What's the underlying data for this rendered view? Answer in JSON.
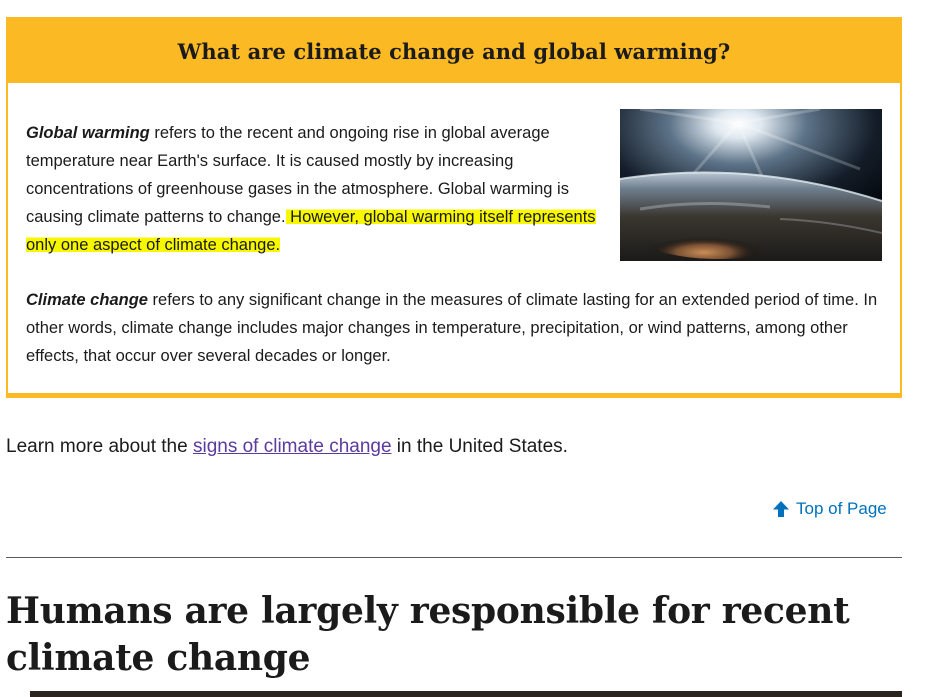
{
  "box": {
    "title": "What are climate change and global warming?",
    "p1": {
      "term": "Global warming",
      "text": " refers to the recent and ongoing rise in global average temperature near Earth's surface. It is caused mostly by increasing concentrations of greenhouse gases in the atmosphere. Global warming is causing climate patterns to change.",
      "highlighted": " However, global warming itself represents only one aspect of climate change."
    },
    "p2": {
      "term": "Climate change",
      "text": " refers to any significant change in the measures of climate lasting for an extended period of time. In other words, climate change includes major changes in temperature, precipitation, or wind patterns, among other effects, that occur over several decades or longer."
    },
    "image": "earth-from-space-image"
  },
  "learn_more": {
    "prefix": "Learn more about the ",
    "link": "signs of climate change",
    "suffix": " in the United States."
  },
  "top_of_page": "Top of Page",
  "section_heading": "Humans are largely responsible for recent climate change",
  "colors": {
    "accent": "#fbb924",
    "highlight": "#f7f700",
    "link_visited": "#5c3a9e",
    "link": "#0071bc"
  }
}
